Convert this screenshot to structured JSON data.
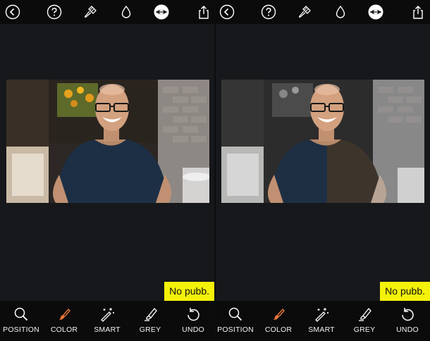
{
  "panels": [
    {
      "id": "before",
      "no_ads_badge": "No pubb.",
      "tools": [
        {
          "key": "position",
          "label": "POSITION",
          "icon": "magnifier-icon"
        },
        {
          "key": "color",
          "label": "COLOR",
          "icon": "brush-icon"
        },
        {
          "key": "smart",
          "label": "SMART",
          "icon": "magic-wand-icon"
        },
        {
          "key": "grey",
          "label": "GREY",
          "icon": "highlighter-icon"
        },
        {
          "key": "undo",
          "label": "UNDO",
          "icon": "undo-icon"
        }
      ]
    },
    {
      "id": "after",
      "no_ads_badge": "No pubb.",
      "tools": [
        {
          "key": "position",
          "label": "POSITION",
          "icon": "magnifier-icon"
        },
        {
          "key": "color",
          "label": "COLOR",
          "icon": "brush-icon"
        },
        {
          "key": "smart",
          "label": "SMART",
          "icon": "magic-wand-icon"
        },
        {
          "key": "grey",
          "label": "GREY",
          "icon": "highlighter-icon"
        },
        {
          "key": "undo",
          "label": "UNDO",
          "icon": "undo-icon"
        }
      ]
    }
  ],
  "top_icons": [
    "back-icon",
    "help-icon",
    "brush-settings-icon",
    "drop-icon",
    "compare-icon",
    "share-icon"
  ],
  "colors": {
    "background": "#16181b",
    "bars": "#0b0b0c",
    "badge": "#f4f20a",
    "active_tool": "#e8773a"
  }
}
